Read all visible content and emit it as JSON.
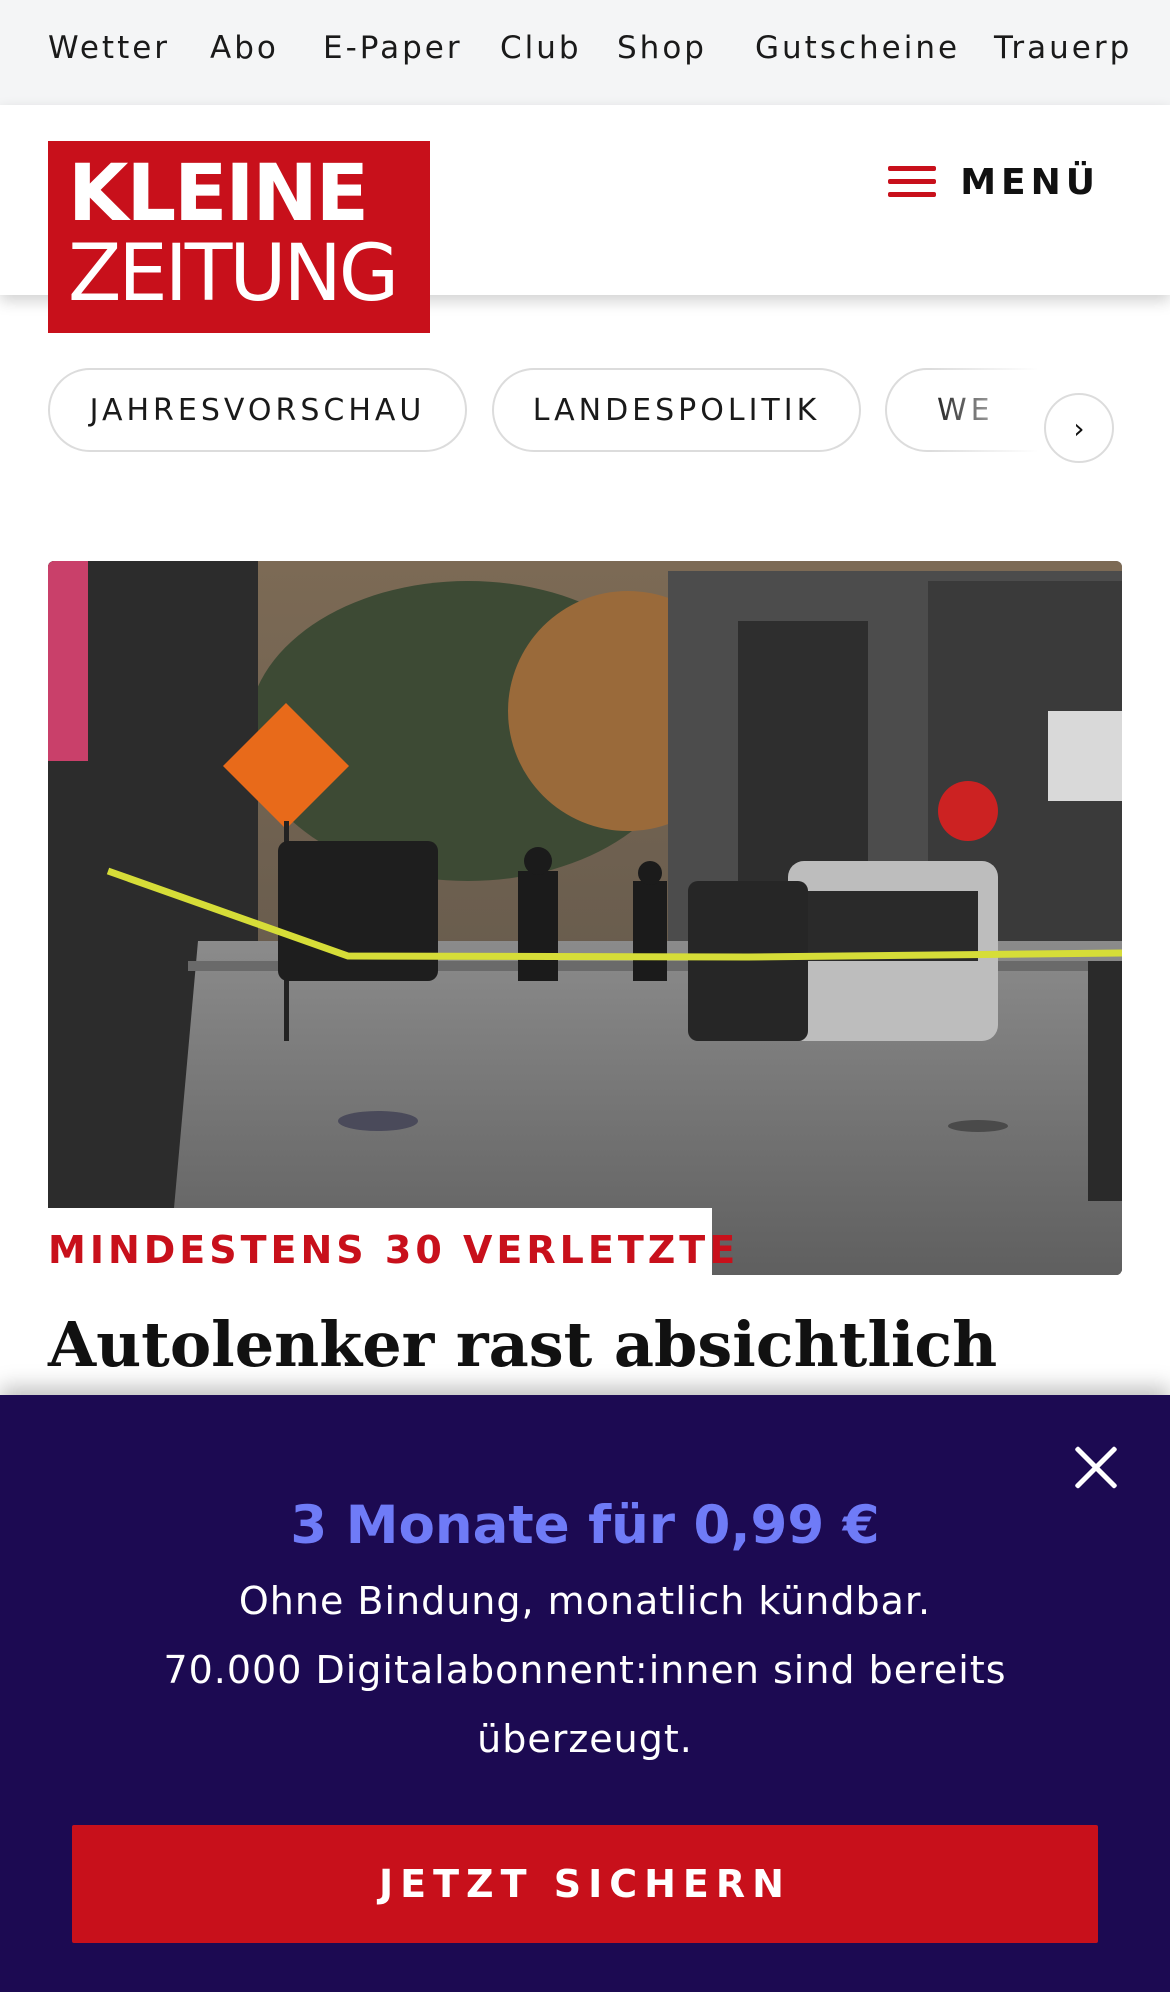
{
  "servicebar": {
    "items": [
      "Wetter",
      "Abo",
      "E-Paper",
      "Club",
      "Shop",
      "Gutscheine",
      "Trauerp"
    ]
  },
  "header": {
    "logo_line1": "KLEINE",
    "logo_line2": "ZEITUNG",
    "menu_label": "MENÜ",
    "brand_color": "#c8101b"
  },
  "topics": {
    "pills": [
      "JAHRESVORSCHAU",
      "LANDESPOLITIK",
      "WE"
    ],
    "next_icon": "chevron-right-icon"
  },
  "article": {
    "kicker": "MINDESTENS 30 VERLETZTE",
    "headline": "Autolenker rast absichtlich"
  },
  "paywall": {
    "title": "3 Monate für 0,99 €",
    "line1": "Ohne Bindung, monatlich kündbar.",
    "line2": "70.000 Digitalabonnent:innen sind bereits",
    "line3": "überzeugt.",
    "cta_label": "JETZT SICHERN",
    "background": "#1c0a52",
    "accent": "#6f7bf7"
  }
}
